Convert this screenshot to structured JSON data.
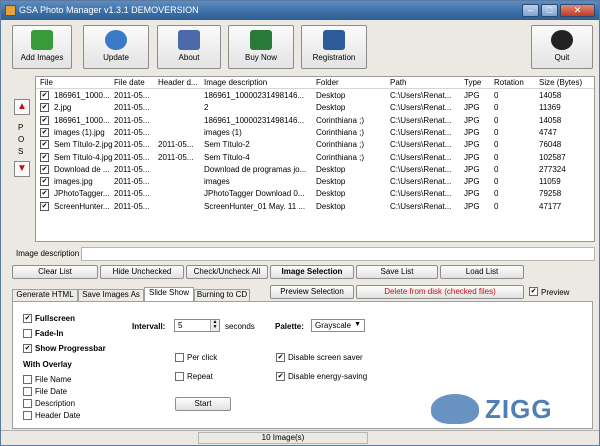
{
  "window": {
    "title": "GSA Photo Manager v1.3.1  DEMOVERSION",
    "min": "–",
    "max": "□",
    "close": "✕"
  },
  "toolbar": [
    {
      "label": "Add Images",
      "icon": "add-images-icon",
      "color": "#3a9a3a"
    },
    {
      "label": "Update",
      "icon": "update-globe-icon",
      "color": "#3a78c8"
    },
    {
      "label": "About",
      "icon": "about-info-icon",
      "color": "#4a6aaa"
    },
    {
      "label": "Buy Now",
      "icon": "buy-now-book-icon",
      "color": "#2a7a3a"
    },
    {
      "label": "Registration",
      "icon": "registration-check-icon",
      "color": "#2c5a9a"
    },
    {
      "label": "Quit",
      "icon": "power-icon",
      "color": "#222222"
    }
  ],
  "pos": {
    "up": "▲",
    "letters": [
      "P",
      "O",
      "S"
    ],
    "down": "▼"
  },
  "columns": [
    "File",
    "File date",
    "Header d...",
    "Image description",
    "Folder",
    "Path",
    "Type",
    "Rotation",
    "Size (Bytes)"
  ],
  "rows": [
    [
      "186961_1000...",
      "2011-05...",
      "",
      "186961_10000231498146...",
      "Desktop",
      "C:\\Users\\Renat...",
      "JPG",
      "0",
      "14058"
    ],
    [
      "2.jpg",
      "2011-05...",
      "",
      "2",
      "Desktop",
      "C:\\Users\\Renat...",
      "JPG",
      "0",
      "11369"
    ],
    [
      "186961_1000...",
      "2011-05...",
      "",
      "186961_10000231498146...",
      "Corinthiana ;)",
      "C:\\Users\\Renat...",
      "JPG",
      "0",
      "14058"
    ],
    [
      "images (1).jpg",
      "2011-05...",
      "",
      "images (1)",
      "Corinthiana ;)",
      "C:\\Users\\Renat...",
      "JPG",
      "0",
      "4747"
    ],
    [
      "Sem Título-2.jpg",
      "2011-05...",
      "2011-05...",
      "Sem Título-2",
      "Corinthiana ;)",
      "C:\\Users\\Renat...",
      "JPG",
      "0",
      "76048"
    ],
    [
      "Sem Título-4.jpg",
      "2011-05...",
      "2011-05...",
      "Sem Título-4",
      "Corinthiana ;)",
      "C:\\Users\\Renat...",
      "JPG",
      "0",
      "102587"
    ],
    [
      "Download de ...",
      "2011-05...",
      "",
      "Download de programas jo...",
      "Desktop",
      "C:\\Users\\Renat...",
      "JPG",
      "0",
      "277324"
    ],
    [
      "images.jpg",
      "2011-05...",
      "",
      "images",
      "Desktop",
      "C:\\Users\\Renat...",
      "JPG",
      "0",
      "11059"
    ],
    [
      "JPhotoTagger...",
      "2011-05...",
      "",
      "JPhotoTagger Download 0...",
      "Desktop",
      "C:\\Users\\Renat...",
      "JPG",
      "0",
      "79258"
    ],
    [
      "ScreenHunter...",
      "2011-05...",
      "",
      "ScreenHunter_01 May. 11 ...",
      "Desktop",
      "C:\\Users\\Renat...",
      "JPG",
      "0",
      "47177"
    ]
  ],
  "desc_label": "Image description",
  "buttons": [
    "Clear List",
    "Hide Unchecked",
    "Check/Uncheck All",
    "Image Selection",
    "Save List",
    "Load List"
  ],
  "tabs": [
    "Generate HTML",
    "Save Images As",
    "Slide Show",
    "Burning to CD"
  ],
  "preview_sel": "Preview Selection",
  "delete_btn": "Delete from disk (checked files)",
  "preview_chk": "Preview",
  "slideshow": {
    "fullscreen": "Fullscreen",
    "fadein": "Fade-In",
    "progressbar": "Show Progressbar",
    "overlay": "With Overlay",
    "file_name": "File Name",
    "file_date": "File Date",
    "description": "Description",
    "header_date": "Header Date",
    "interval_label": "Intervall:",
    "interval_value": "5",
    "seconds": "seconds",
    "palette_label": "Palette:",
    "palette_value": "Grayscale",
    "per_click": "Per click",
    "repeat": "Repeat",
    "disable_saver": "Disable screen saver",
    "disable_energy": "Disable energy-saving",
    "start": "Start"
  },
  "status": "10 Image(s)",
  "watermark": "ZIGG"
}
